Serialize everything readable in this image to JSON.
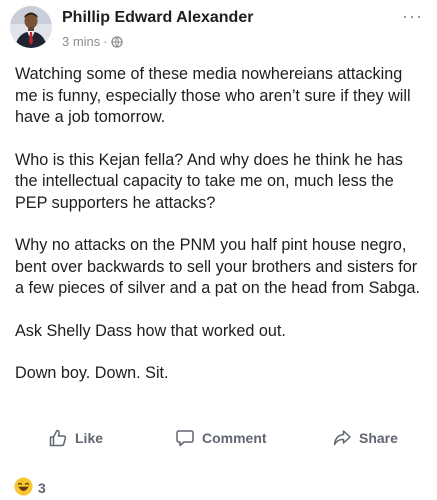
{
  "post": {
    "author": "Phillip Edward Alexander",
    "timestamp": "3 mins",
    "separator": "·",
    "audience_icon": "globe-icon",
    "more_icon": "more-options-icon",
    "more_glyph": "···",
    "paragraphs": [
      "Watching some of these media nowhereians attacking me is funny, especially those who aren’t sure if they will have a job tomorrow.",
      "Who is this Kejan fella? And why does he think he has the intellectual capacity to take me on, much less the PEP supporters he attacks?",
      "Why no attacks on the PNM you half pint house negro, bent over backwards to sell your brothers and sisters for a few pieces of silver and a pat on the head from Sabga.",
      "Ask Shelly Dass how that worked out.",
      "Down boy. Down. Sit."
    ]
  },
  "actions": {
    "like": {
      "label": "Like",
      "icon": "thumbs-up-icon"
    },
    "comment": {
      "label": "Comment",
      "icon": "comment-bubble-icon"
    },
    "share": {
      "label": "Share",
      "icon": "share-arrow-icon"
    }
  },
  "reactions": {
    "icon": "laughing-emoji-icon",
    "count": "3"
  },
  "colors": {
    "text": "#1c1e21",
    "secondary_text": "#8a8d91",
    "action_text": "#606770",
    "emoji_yellow": "#f7c530"
  }
}
